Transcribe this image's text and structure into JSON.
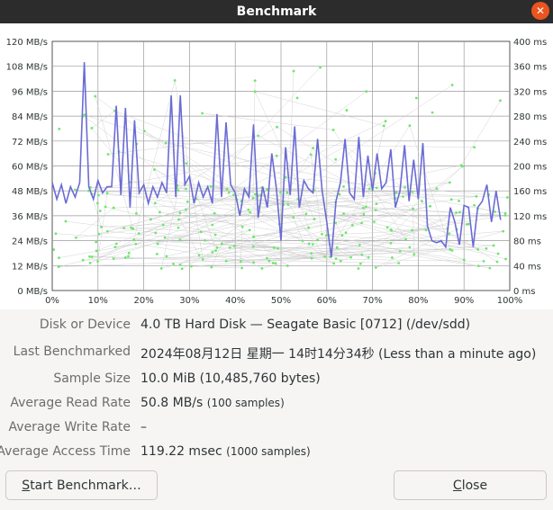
{
  "window": {
    "title": "Benchmark"
  },
  "chart_data": {
    "type": "line",
    "x_unit": "percent of device",
    "xlim": [
      0,
      100
    ],
    "x_ticks": [
      "0%",
      "10%",
      "20%",
      "30%",
      "40%",
      "50%",
      "60%",
      "70%",
      "80%",
      "90%",
      "100%"
    ],
    "left_ticks": [
      "0 MB/s",
      "12 MB/s",
      "24 MB/s",
      "36 MB/s",
      "48 MB/s",
      "60 MB/s",
      "72 MB/s",
      "84 MB/s",
      "96 MB/s",
      "108 MB/s",
      "120 MB/s"
    ],
    "right_ticks": [
      "0 ms",
      "40 ms",
      "80 ms",
      "120 ms",
      "160 ms",
      "200 ms",
      "240 ms",
      "280 ms",
      "320 ms",
      "360 ms",
      "400 ms"
    ],
    "ylim_left": [
      0,
      120
    ],
    "ylim_right": [
      0,
      400
    ],
    "grid": true,
    "read_rate_series": {
      "unit": "MB/s",
      "color": "#6b6bd6",
      "x": [
        0,
        1,
        2,
        3,
        4,
        5,
        6,
        7,
        8,
        9,
        10,
        11,
        12,
        13,
        14,
        15,
        16,
        17,
        18,
        19,
        20,
        21,
        22,
        23,
        24,
        25,
        26,
        27,
        28,
        29,
        30,
        31,
        32,
        33,
        34,
        35,
        36,
        37,
        38,
        39,
        40,
        41,
        42,
        43,
        44,
        45,
        46,
        47,
        48,
        49,
        50,
        51,
        52,
        53,
        54,
        55,
        56,
        57,
        58,
        59,
        60,
        61,
        62,
        63,
        64,
        65,
        66,
        67,
        68,
        69,
        70,
        71,
        72,
        73,
        74,
        75,
        76,
        77,
        78,
        79,
        80,
        81,
        82,
        83,
        84,
        85,
        86,
        87,
        88,
        89,
        90,
        91,
        92,
        93,
        94,
        95,
        96,
        97,
        98
      ],
      "values": [
        52,
        44,
        51,
        42,
        50,
        45,
        52,
        110,
        50,
        44,
        53,
        47,
        50,
        50,
        89,
        46,
        88,
        40,
        82,
        47,
        51,
        42,
        50,
        45,
        52,
        47,
        94,
        45,
        94,
        51,
        55,
        42,
        52,
        45,
        50,
        42,
        85,
        45,
        81,
        51,
        47,
        36,
        49,
        45,
        80,
        35,
        50,
        40,
        66,
        49,
        24,
        69,
        46,
        79,
        40,
        53,
        49,
        47,
        73,
        48,
        33,
        16,
        43,
        52,
        73,
        47,
        44,
        74,
        45,
        65,
        48,
        66,
        49,
        52,
        68,
        40,
        48,
        70,
        43,
        63,
        44,
        71,
        31,
        24,
        23,
        24,
        21,
        40,
        33,
        22,
        41,
        40,
        21,
        40,
        43,
        51,
        33,
        48,
        34
      ]
    },
    "access_time_series": {
      "unit": "ms",
      "style": "scatter",
      "color": "#6be86b"
    }
  },
  "info": {
    "device_label": "Disk or Device",
    "device_value": "4.0 TB Hard Disk — Seagate Basic [0712] (/dev/sdd)",
    "last_label": "Last Benchmarked",
    "last_value": "2024年08月12日 星期一 14时14分34秒 (Less than a minute ago)",
    "sample_label": "Sample Size",
    "sample_value": "10.0 MiB (10,485,760 bytes)",
    "read_label": "Average Read Rate",
    "read_value": "50.8 MB/s",
    "read_samples": "(100 samples)",
    "write_label": "Average Write Rate",
    "write_value": "–",
    "access_label": "Average Access Time",
    "access_value": "119.22 msec",
    "access_samples": "(1000 samples)"
  },
  "buttons": {
    "start_first": "S",
    "start_rest": "tart Benchmark…",
    "close_first": "C",
    "close_rest": "lose"
  }
}
